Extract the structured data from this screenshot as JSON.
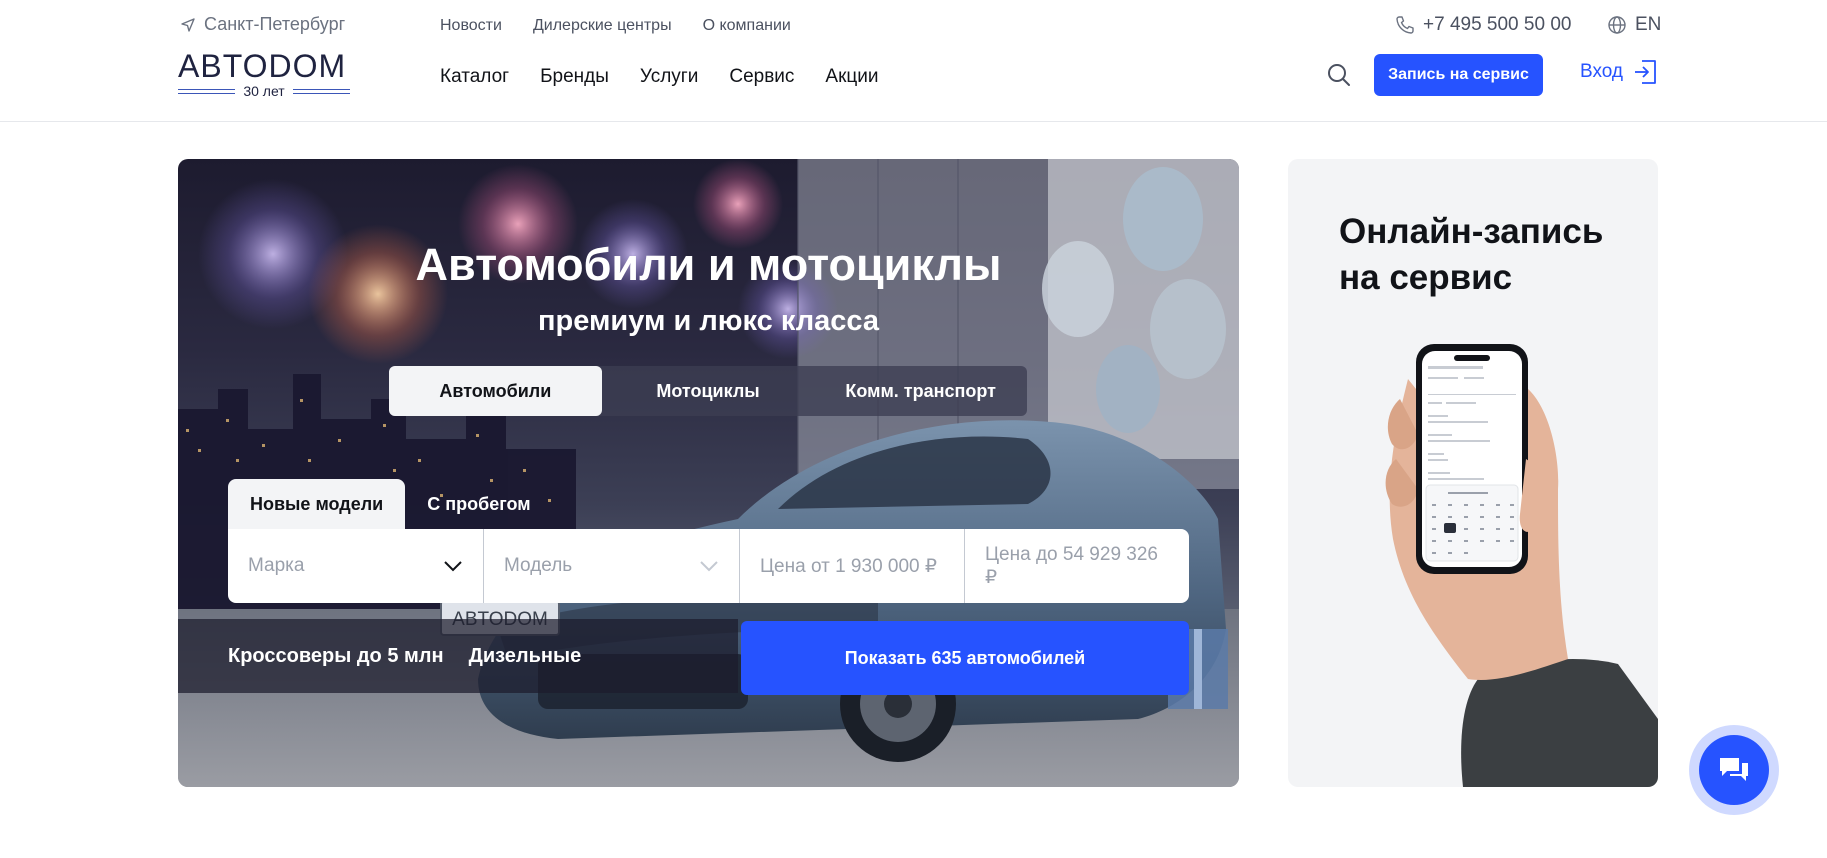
{
  "header": {
    "city": "Санкт-Петербург",
    "logo_text": "ABTODOM",
    "logo_sub": "30 лет",
    "top_links": [
      "Новости",
      "Дилерские центры",
      "О компании"
    ],
    "main_nav": [
      "Каталог",
      "Бренды",
      "Услуги",
      "Сервис",
      "Акции"
    ],
    "phone": "+7 495 500 50 00",
    "lang": "EN",
    "service_button": "Запись на сервис",
    "login": "Вход"
  },
  "hero": {
    "title": "Автомобили и мотоциклы",
    "subtitle": "премиум и люкс класса",
    "vehicle_tabs": [
      "Автомобили",
      "Мотоциклы",
      "Комм. транспорт"
    ],
    "active_vehicle_tab": "Автомобили",
    "condition_tabs": [
      "Новые модели",
      "С пробегом"
    ],
    "active_condition_tab": "Новые модели",
    "filters": {
      "brand_placeholder": "Марка",
      "model_placeholder": "Модель",
      "price_from_placeholder": "Цена от 1 930 000 ₽",
      "price_to_placeholder": "Цена до 54 929 326 ₽"
    },
    "quick_links": [
      "Кроссоверы до 5 млн",
      "Дизельные"
    ],
    "show_button": "Показать 635 автомобилей",
    "plate_text": "ABTODOM"
  },
  "side_card": {
    "title_line1": "Онлайн-запись",
    "title_line2": "на сервис"
  },
  "colors": {
    "accent": "#2653ff",
    "text": "#111318",
    "muted": "#6b7280",
    "card_bg": "#f3f4f6"
  },
  "icons": [
    "location-arrow-icon",
    "phone-icon",
    "globe-icon",
    "search-icon",
    "login-icon",
    "chevron-down-icon",
    "chat-icon"
  ]
}
